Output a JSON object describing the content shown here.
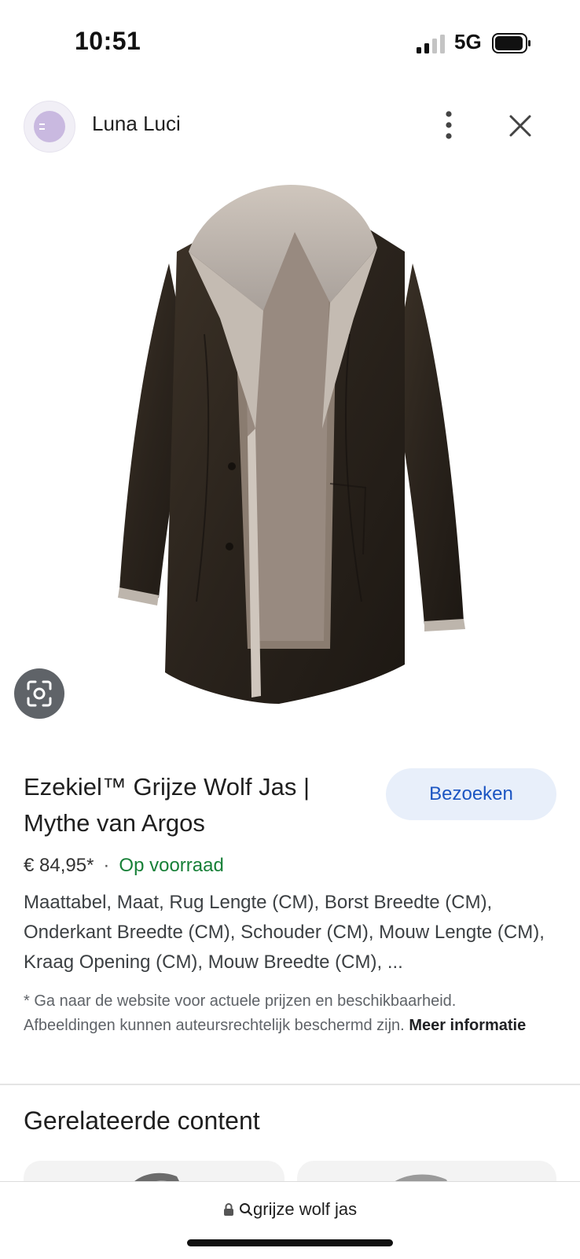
{
  "status_bar": {
    "time": "10:51",
    "network": "5G"
  },
  "header": {
    "site_name": "Luna Luci"
  },
  "product": {
    "title": "Ezekiel™ Grijze Wolf Jas | Mythe van Argos",
    "visit_label": "Bezoeken",
    "price": "€ 84,95*",
    "separator": "·",
    "stock": "Op voorraad",
    "description": "Maattabel, Maat, Rug Lengte (CM), Borst Breedte (CM), Onderkant Breedte (CM), Schouder (CM), Mouw Lengte (CM), Kraag Opening (CM), Mouw Breedte (CM), ...",
    "disclaimer": "* Ga naar de website voor actuele prijzen en beschikbaarheid. Afbeeldingen kunnen auteursrechtelijk beschermd zijn.",
    "more_info": "Meer informatie"
  },
  "related": {
    "title": "Gerelateerde content"
  },
  "address_bar": {
    "url": "grijze wolf jas"
  },
  "colors": {
    "accent": "#1b55c2",
    "stock_green": "#188038",
    "button_bg": "#e8effa"
  }
}
